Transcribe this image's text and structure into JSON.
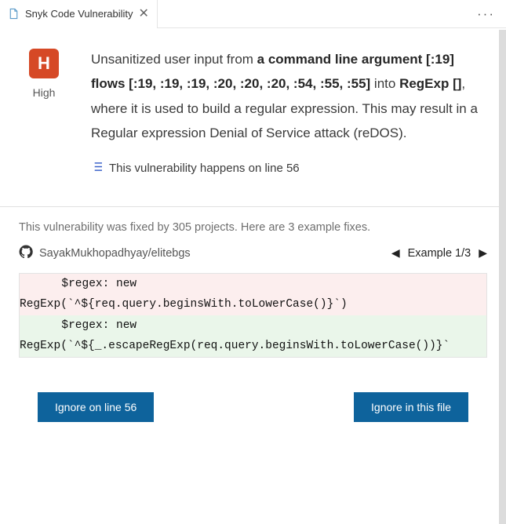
{
  "tab": {
    "title": "Snyk Code Vulnerability"
  },
  "severity": {
    "letter": "H",
    "label": "High"
  },
  "description": {
    "pre": "Unsanitized user input from ",
    "bold1": "a command line argument [:19] flows [:19, :19, :19, :20, :20, :20, :54, :55, :55]",
    "mid": " into ",
    "bold2": "RegExp []",
    "post": ", where it is used to build a regular expression. This may result in a Regular expression Denial of Service attack (reDOS)."
  },
  "line_info": "This vulnerability happens on line 56",
  "fixes": {
    "intro": "This vulnerability was fixed by 305 projects. Here are 3 example fixes.",
    "repo": "SayakMukhopadhyay/elitebgs",
    "pager_label": "Example 1/3"
  },
  "diff": {
    "removed_1": "  $regex: new",
    "removed_2": "RegExp(`^${req.query.beginsWith.toLowerCase()}`)",
    "added_1": "  $regex: new",
    "added_2": "RegExp(`^${_.escapeRegExp(req.query.beginsWith.toLowerCase())}`"
  },
  "actions": {
    "ignore_line": "Ignore on line 56",
    "ignore_file": "Ignore in this file"
  }
}
